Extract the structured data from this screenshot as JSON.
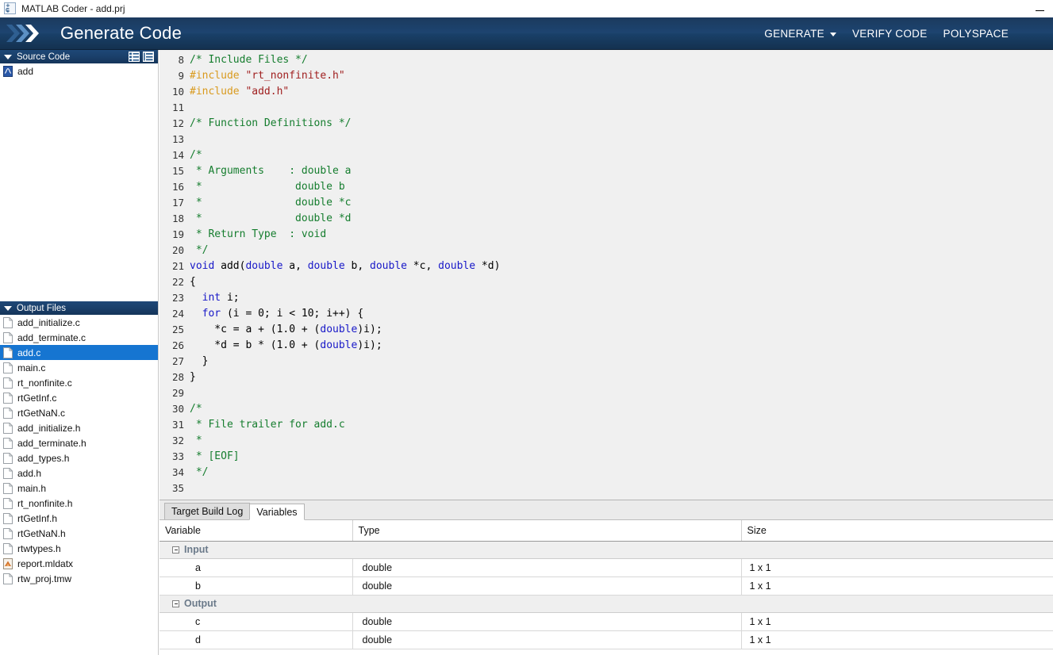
{
  "window": {
    "title": "MATLAB Coder - add.prj",
    "app_icon": "matlab-coder-icon",
    "minimize_label": "Minimize"
  },
  "header": {
    "logo": "chevron-logo",
    "title": "Generate Code",
    "menu": [
      {
        "label": "GENERATE",
        "has_caret": true,
        "name": "generate-menu"
      },
      {
        "label": "VERIFY CODE",
        "has_caret": false,
        "name": "verify-code-menu"
      },
      {
        "label": "POLYSPACE",
        "has_caret": false,
        "name": "polyspace-menu"
      }
    ]
  },
  "sidebar": {
    "source_code": {
      "title": "Source Code",
      "icons": [
        "list-view-icon",
        "tree-view-icon"
      ],
      "items": [
        {
          "label": "add",
          "icon": "matlab-file-icon",
          "selected": false
        }
      ]
    },
    "output_files": {
      "title": "Output Files",
      "items": [
        {
          "label": "add_initialize.c",
          "icon": "file-icon",
          "selected": false
        },
        {
          "label": "add_terminate.c",
          "icon": "file-icon",
          "selected": false
        },
        {
          "label": "add.c",
          "icon": "file-icon",
          "selected": true
        },
        {
          "label": "main.c",
          "icon": "file-icon",
          "selected": false
        },
        {
          "label": "rt_nonfinite.c",
          "icon": "file-icon",
          "selected": false
        },
        {
          "label": "rtGetInf.c",
          "icon": "file-icon",
          "selected": false
        },
        {
          "label": "rtGetNaN.c",
          "icon": "file-icon",
          "selected": false
        },
        {
          "label": "add_initialize.h",
          "icon": "file-icon",
          "selected": false
        },
        {
          "label": "add_terminate.h",
          "icon": "file-icon",
          "selected": false
        },
        {
          "label": "add_types.h",
          "icon": "file-icon",
          "selected": false
        },
        {
          "label": "add.h",
          "icon": "file-icon",
          "selected": false
        },
        {
          "label": "main.h",
          "icon": "file-icon",
          "selected": false
        },
        {
          "label": "rt_nonfinite.h",
          "icon": "file-icon",
          "selected": false
        },
        {
          "label": "rtGetInf.h",
          "icon": "file-icon",
          "selected": false
        },
        {
          "label": "rtGetNaN.h",
          "icon": "file-icon",
          "selected": false
        },
        {
          "label": "rtwtypes.h",
          "icon": "file-icon",
          "selected": false
        },
        {
          "label": "report.mldatx",
          "icon": "report-icon",
          "selected": false
        },
        {
          "label": "rtw_proj.tmw",
          "icon": "file-icon",
          "selected": false
        }
      ]
    }
  },
  "editor": {
    "lines": [
      {
        "n": "8",
        "spans": [
          {
            "t": "/* Include Files */",
            "c": "c-com"
          }
        ]
      },
      {
        "n": "9",
        "spans": [
          {
            "t": "#include",
            "c": "c-pre"
          },
          {
            "t": " ",
            "c": "c-pln"
          },
          {
            "t": "\"rt_nonfinite.h\"",
            "c": "c-str"
          }
        ]
      },
      {
        "n": "10",
        "spans": [
          {
            "t": "#include",
            "c": "c-pre"
          },
          {
            "t": " ",
            "c": "c-pln"
          },
          {
            "t": "\"add.h\"",
            "c": "c-str"
          }
        ]
      },
      {
        "n": "11",
        "spans": []
      },
      {
        "n": "12",
        "spans": [
          {
            "t": "/* Function Definitions */",
            "c": "c-com"
          }
        ]
      },
      {
        "n": "13",
        "spans": []
      },
      {
        "n": "14",
        "spans": [
          {
            "t": "/*",
            "c": "c-com"
          }
        ]
      },
      {
        "n": "15",
        "spans": [
          {
            "t": " * Arguments    : double a",
            "c": "c-com"
          }
        ]
      },
      {
        "n": "16",
        "spans": [
          {
            "t": " *               double b",
            "c": "c-com"
          }
        ]
      },
      {
        "n": "17",
        "spans": [
          {
            "t": " *               double *c",
            "c": "c-com"
          }
        ]
      },
      {
        "n": "18",
        "spans": [
          {
            "t": " *               double *d",
            "c": "c-com"
          }
        ]
      },
      {
        "n": "19",
        "spans": [
          {
            "t": " * Return Type  : void",
            "c": "c-com"
          }
        ]
      },
      {
        "n": "20",
        "spans": [
          {
            "t": " */",
            "c": "c-com"
          }
        ]
      },
      {
        "n": "21",
        "spans": [
          {
            "t": "void",
            "c": "c-kw"
          },
          {
            "t": " add(",
            "c": "c-pln"
          },
          {
            "t": "double",
            "c": "c-kw"
          },
          {
            "t": " a, ",
            "c": "c-pln"
          },
          {
            "t": "double",
            "c": "c-kw"
          },
          {
            "t": " b, ",
            "c": "c-pln"
          },
          {
            "t": "double",
            "c": "c-kw"
          },
          {
            "t": " *c, ",
            "c": "c-pln"
          },
          {
            "t": "double",
            "c": "c-kw"
          },
          {
            "t": " *d)",
            "c": "c-pln"
          }
        ]
      },
      {
        "n": "22",
        "spans": [
          {
            "t": "{",
            "c": "c-pln"
          }
        ]
      },
      {
        "n": "23",
        "spans": [
          {
            "t": "  ",
            "c": "c-pln"
          },
          {
            "t": "int",
            "c": "c-kw"
          },
          {
            "t": " i;",
            "c": "c-pln"
          }
        ]
      },
      {
        "n": "24",
        "spans": [
          {
            "t": "  ",
            "c": "c-pln"
          },
          {
            "t": "for",
            "c": "c-kw"
          },
          {
            "t": " (i = 0; i < 10; i++) {",
            "c": "c-pln"
          }
        ]
      },
      {
        "n": "25",
        "spans": [
          {
            "t": "    *c = a + (1.0 + (",
            "c": "c-pln"
          },
          {
            "t": "double",
            "c": "c-kw"
          },
          {
            "t": ")i);",
            "c": "c-pln"
          }
        ]
      },
      {
        "n": "26",
        "spans": [
          {
            "t": "    *d = b * (1.0 + (",
            "c": "c-pln"
          },
          {
            "t": "double",
            "c": "c-kw"
          },
          {
            "t": ")i);",
            "c": "c-pln"
          }
        ]
      },
      {
        "n": "27",
        "spans": [
          {
            "t": "  }",
            "c": "c-pln"
          }
        ]
      },
      {
        "n": "28",
        "spans": [
          {
            "t": "}",
            "c": "c-pln"
          }
        ]
      },
      {
        "n": "29",
        "spans": []
      },
      {
        "n": "30",
        "spans": [
          {
            "t": "/*",
            "c": "c-com"
          }
        ]
      },
      {
        "n": "31",
        "spans": [
          {
            "t": " * File trailer for add.c",
            "c": "c-com"
          }
        ]
      },
      {
        "n": "32",
        "spans": [
          {
            "t": " *",
            "c": "c-com"
          }
        ]
      },
      {
        "n": "33",
        "spans": [
          {
            "t": " * [EOF]",
            "c": "c-com"
          }
        ]
      },
      {
        "n": "34",
        "spans": [
          {
            "t": " */",
            "c": "c-com"
          }
        ]
      },
      {
        "n": "35",
        "spans": []
      }
    ]
  },
  "bottom_panel": {
    "tabs": [
      {
        "label": "Target Build Log",
        "active": false,
        "name": "tab-target-build-log"
      },
      {
        "label": "Variables",
        "active": true,
        "name": "tab-variables"
      }
    ],
    "table": {
      "columns": [
        "Variable",
        "Type",
        "Size"
      ],
      "groups": [
        {
          "label": "Input",
          "expanded": true,
          "rows": [
            {
              "variable": "a",
              "type": "double",
              "size": "1 x 1"
            },
            {
              "variable": "b",
              "type": "double",
              "size": "1 x 1"
            }
          ]
        },
        {
          "label": "Output",
          "expanded": true,
          "rows": [
            {
              "variable": "c",
              "type": "double",
              "size": "1 x 1"
            },
            {
              "variable": "d",
              "type": "double",
              "size": "1 x 1"
            }
          ]
        }
      ]
    }
  },
  "colors": {
    "header_blue": "#1d4470",
    "panel_header_blue": "#1a3f6a",
    "selection_blue": "#1675d1",
    "editor_bg": "#f0f0f0",
    "comment_green": "#157d2e",
    "keyword_blue": "#1818c8",
    "preproc_orange": "#d99a1e",
    "string_red": "#a02020"
  }
}
